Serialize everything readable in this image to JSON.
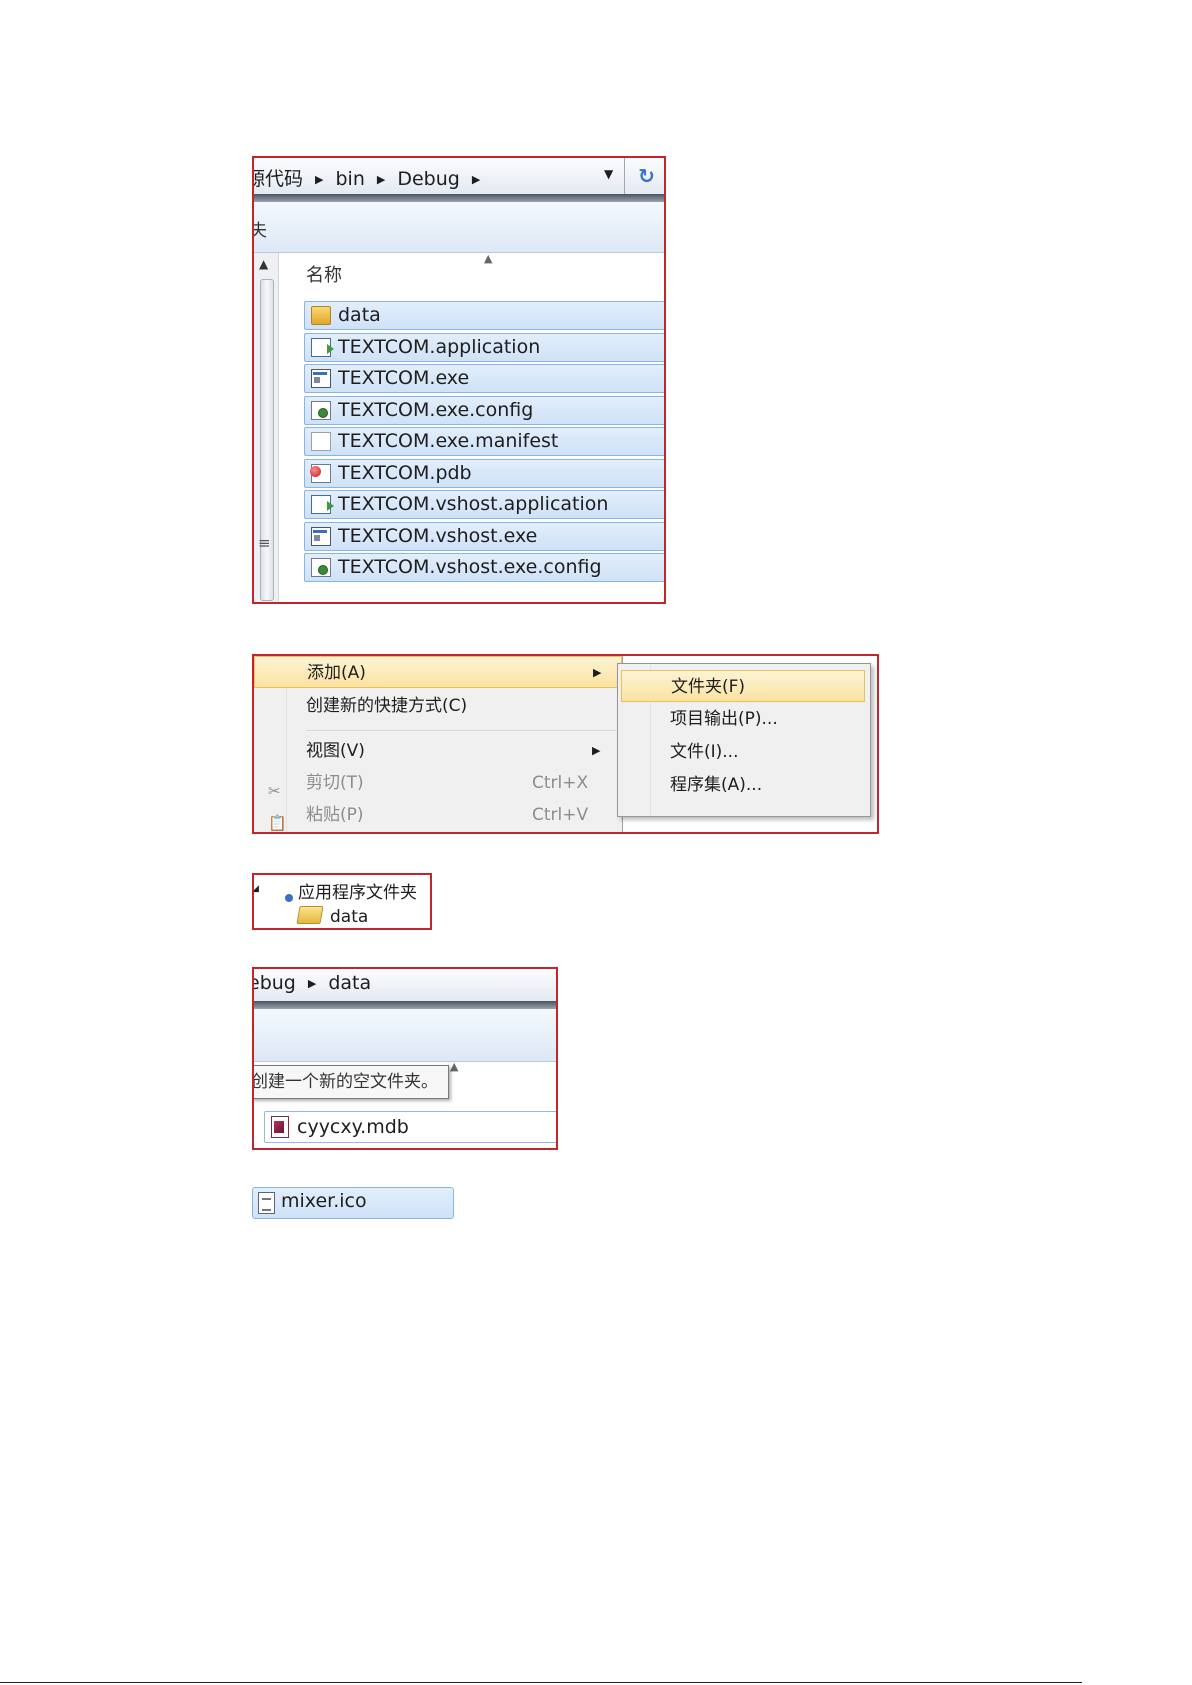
{
  "explorer1": {
    "breadcrumb": [
      "源代码",
      "bin",
      "Debug"
    ],
    "toolbar_fragment": "夫",
    "column_header": "名称",
    "files": [
      {
        "name": "data",
        "icon": "folder-icon"
      },
      {
        "name": "TEXTCOM.application",
        "icon": "application-icon"
      },
      {
        "name": "TEXTCOM.exe",
        "icon": "exe-icon"
      },
      {
        "name": "TEXTCOM.exe.config",
        "icon": "config-icon"
      },
      {
        "name": "TEXTCOM.exe.manifest",
        "icon": "document-icon"
      },
      {
        "name": "TEXTCOM.pdb",
        "icon": "pdb-icon"
      },
      {
        "name": "TEXTCOM.vshost.application",
        "icon": "application-icon"
      },
      {
        "name": "TEXTCOM.vshost.exe",
        "icon": "exe-icon"
      },
      {
        "name": "TEXTCOM.vshost.exe.config",
        "icon": "config-icon"
      }
    ]
  },
  "context_menu": {
    "items": [
      {
        "label": "添加(A)",
        "shortcut": "",
        "submenu": true,
        "disabled": false,
        "highlighted": true
      },
      {
        "label": "创建新的快捷方式(C)",
        "shortcut": "",
        "submenu": false,
        "disabled": false,
        "highlighted": false
      },
      {
        "label": "视图(V)",
        "shortcut": "",
        "submenu": true,
        "disabled": false,
        "highlighted": false
      },
      {
        "label": "剪切(T)",
        "shortcut": "Ctrl+X",
        "submenu": false,
        "disabled": true,
        "highlighted": false,
        "icon": "scissors-icon"
      },
      {
        "label": "粘贴(P)",
        "shortcut": "Ctrl+V",
        "submenu": false,
        "disabled": true,
        "highlighted": false,
        "icon": "paste-icon"
      }
    ],
    "submenu": [
      {
        "label": "文件夹(F)",
        "highlighted": true
      },
      {
        "label": "项目输出(P)...",
        "highlighted": false
      },
      {
        "label": "文件(I)...",
        "highlighted": false
      },
      {
        "label": "程序集(A)...",
        "highlighted": false
      }
    ],
    "highlight_color": "#fae3a0"
  },
  "tree": {
    "parent": "应用程序文件夹",
    "child": "data"
  },
  "explorer2": {
    "breadcrumb": [
      "ebug",
      "data"
    ],
    "tooltip": "创建一个新的空文件夹。",
    "file": "cyycxy.mdb"
  },
  "mixer_file": {
    "name": "mixer.ico"
  },
  "colors": {
    "frame_border": "#c0272d",
    "selection_fill": "#cfe2f8",
    "selection_border": "#8ab4e4"
  }
}
